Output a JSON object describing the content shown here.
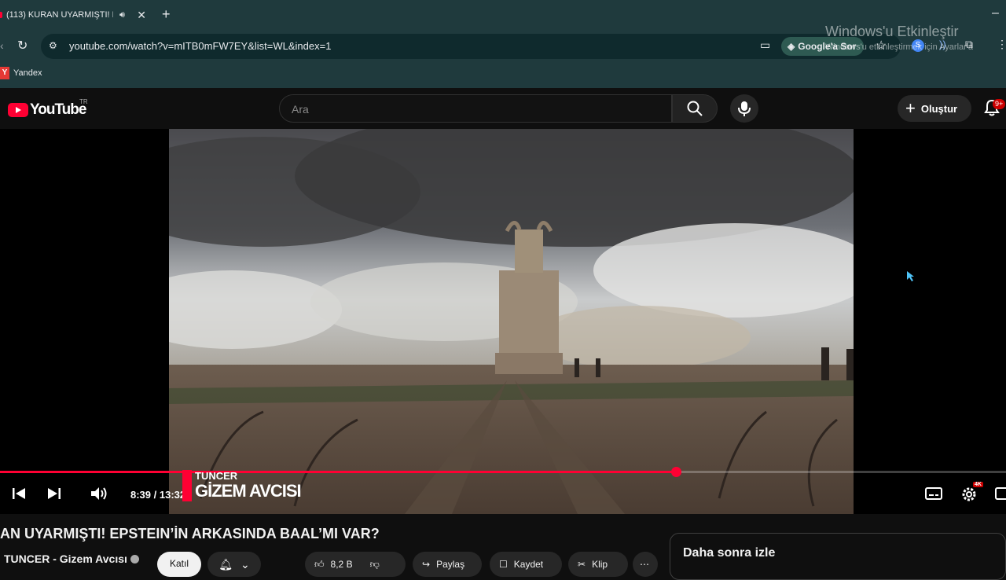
{
  "browser": {
    "tab_title": "(113) KURAN UYARMIŞTI! E",
    "tab_audio_icon": "speaker-icon",
    "url": "youtube.com/watch?v=mITB0mFW7EY&list=WL&index=1",
    "ask_google": "Google'a Sor",
    "bookmark_icon_letter": "Y",
    "bookmark_label": "Yandex"
  },
  "youtube": {
    "logo_text": "YouTube",
    "country": "TR",
    "search_placeholder": "Ara",
    "create_label": "Oluştur",
    "notif_badge": "9+"
  },
  "player": {
    "progress": 0.63,
    "time_text": "8:39 / 13:32",
    "settings_badge": "4K",
    "overlay_top": "TUNCER",
    "overlay_bottom": "GİZEM AVCISI"
  },
  "video": {
    "title": "AN UYARMIŞTI! EPSTEIN’İN ARKASINDA BAAL’MI VAR?",
    "channel": "TUNCER - Gizem Avcısı",
    "join_label": "Katıl",
    "like_count": "8,2 B",
    "share_label": "Paylaş",
    "save_label": "Kaydet",
    "clip_label": "Klip"
  },
  "sidebar": {
    "watch_later": "Daha sonra izle"
  },
  "windows": {
    "activate_title": "Windows'u Etkinleştir",
    "activate_sub": "Windows'u etkinleştirmek için Ayarlar'a"
  },
  "colors": {
    "accent": "#ff0033",
    "chrome_bg": "#1f3a3d",
    "yt_bg": "#0f0f0f"
  }
}
